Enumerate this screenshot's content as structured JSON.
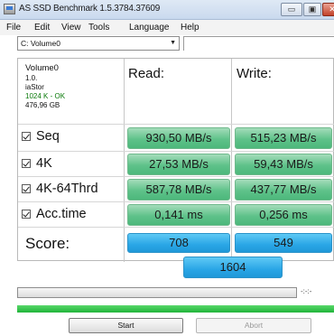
{
  "window": {
    "title": "AS SSD Benchmark 1.5.3784.37609",
    "min": "▭",
    "max": "▣",
    "close": "✕"
  },
  "menu": {
    "items": [
      "File",
      "Edit",
      "View",
      "Tools",
      "Language",
      "Help"
    ]
  },
  "drive": {
    "selected": "C: Volume0"
  },
  "info": {
    "name": "Volume0",
    "version": "1.0.",
    "driver": "iaStor",
    "status": "1024 K - OK",
    "size": "476,96 GB"
  },
  "headers": {
    "read": "Read:",
    "write": "Write:"
  },
  "rows": [
    {
      "label": "Seq",
      "read": "930,50 MB/s",
      "write": "515,23 MB/s"
    },
    {
      "label": "4K",
      "read": "27,53 MB/s",
      "write": "59,43 MB/s"
    },
    {
      "label": "4K-64Thrd",
      "read": "587,78 MB/s",
      "write": "437,77 MB/s"
    },
    {
      "label": "Acc.time",
      "read": "0,141 ms",
      "write": "0,256 ms"
    }
  ],
  "score": {
    "label": "Score:",
    "read": "708",
    "write": "549",
    "total": "1604"
  },
  "progress": {
    "time": "-:-:-",
    "fraction": 0.0,
    "completed_fraction": 1.0
  },
  "buttons": {
    "start": "Start",
    "abort": "Abort"
  }
}
